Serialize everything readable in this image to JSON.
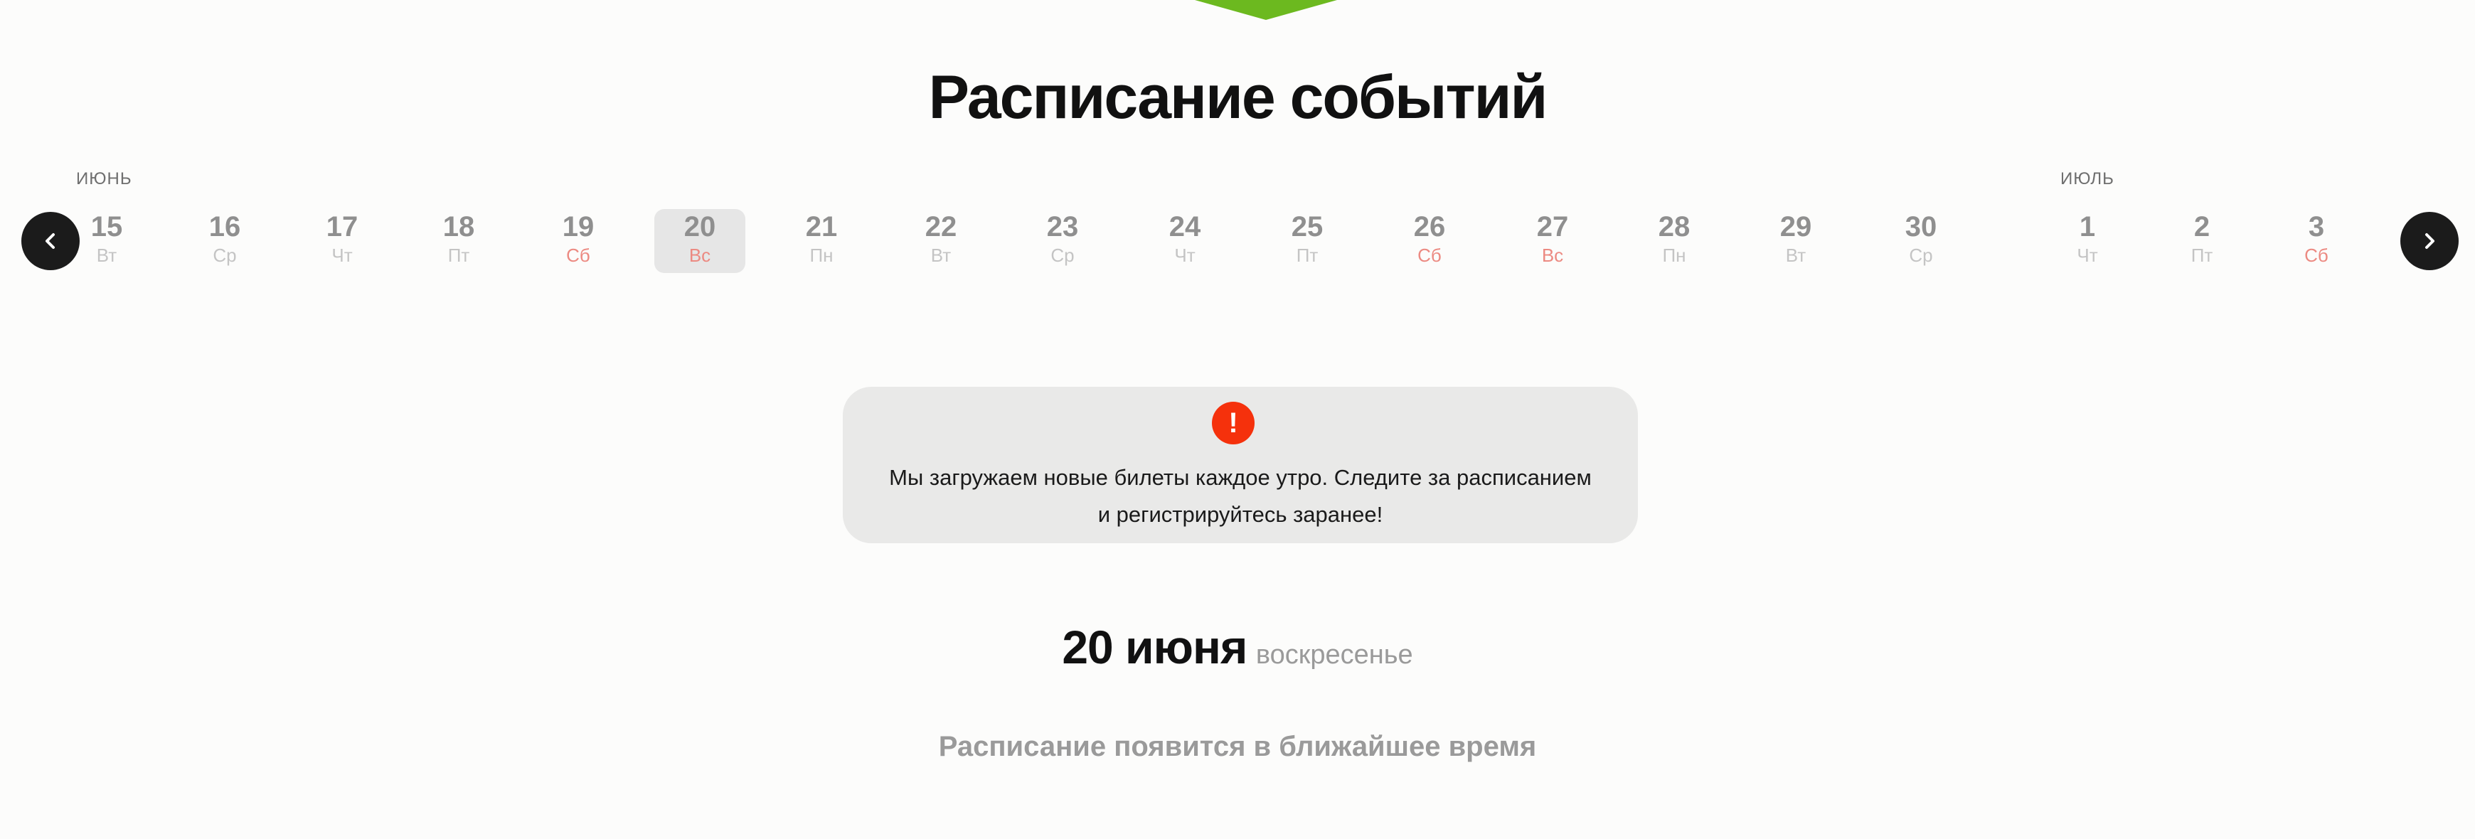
{
  "header": {
    "title": "Расписание событий"
  },
  "colors": {
    "accent_green": "#6cb91f",
    "alert_red": "#f5310c",
    "weekend": "#ec8a82"
  },
  "calendar": {
    "months": [
      "ИЮНЬ",
      "ИЮЛЬ"
    ],
    "prev_icon": "chevron-left-icon",
    "next_icon": "chevron-right-icon",
    "days": [
      {
        "num": "15",
        "wd": "Вт",
        "weekend": false
      },
      {
        "num": "16",
        "wd": "Ср",
        "weekend": false
      },
      {
        "num": "17",
        "wd": "Чт",
        "weekend": false
      },
      {
        "num": "18",
        "wd": "Пт",
        "weekend": false
      },
      {
        "num": "19",
        "wd": "Сб",
        "weekend": true
      },
      {
        "num": "20",
        "wd": "Вс",
        "weekend": true,
        "selected": true
      },
      {
        "num": "21",
        "wd": "Пн",
        "weekend": false
      },
      {
        "num": "22",
        "wd": "Вт",
        "weekend": false
      },
      {
        "num": "23",
        "wd": "Ср",
        "weekend": false
      },
      {
        "num": "24",
        "wd": "Чт",
        "weekend": false
      },
      {
        "num": "25",
        "wd": "Пт",
        "weekend": false
      },
      {
        "num": "26",
        "wd": "Сб",
        "weekend": true
      },
      {
        "num": "27",
        "wd": "Вс",
        "weekend": true
      },
      {
        "num": "28",
        "wd": "Пн",
        "weekend": false
      },
      {
        "num": "29",
        "wd": "Вт",
        "weekend": false
      },
      {
        "num": "30",
        "wd": "Ср",
        "weekend": false
      },
      {
        "num": "1",
        "wd": "Чт",
        "weekend": false
      },
      {
        "num": "2",
        "wd": "Пт",
        "weekend": false
      },
      {
        "num": "3",
        "wd": "Сб",
        "weekend": true
      }
    ]
  },
  "notice": {
    "icon": "!",
    "line1": "Мы загружаем новые билеты каждое утро. Следите за расписанием",
    "line2": "и регистрируйтесь заранее!"
  },
  "selected_date": {
    "date": "20 июня",
    "weekday": "воскресенье"
  },
  "schedule": {
    "empty_message": "Расписание появится в ближайшее время"
  }
}
